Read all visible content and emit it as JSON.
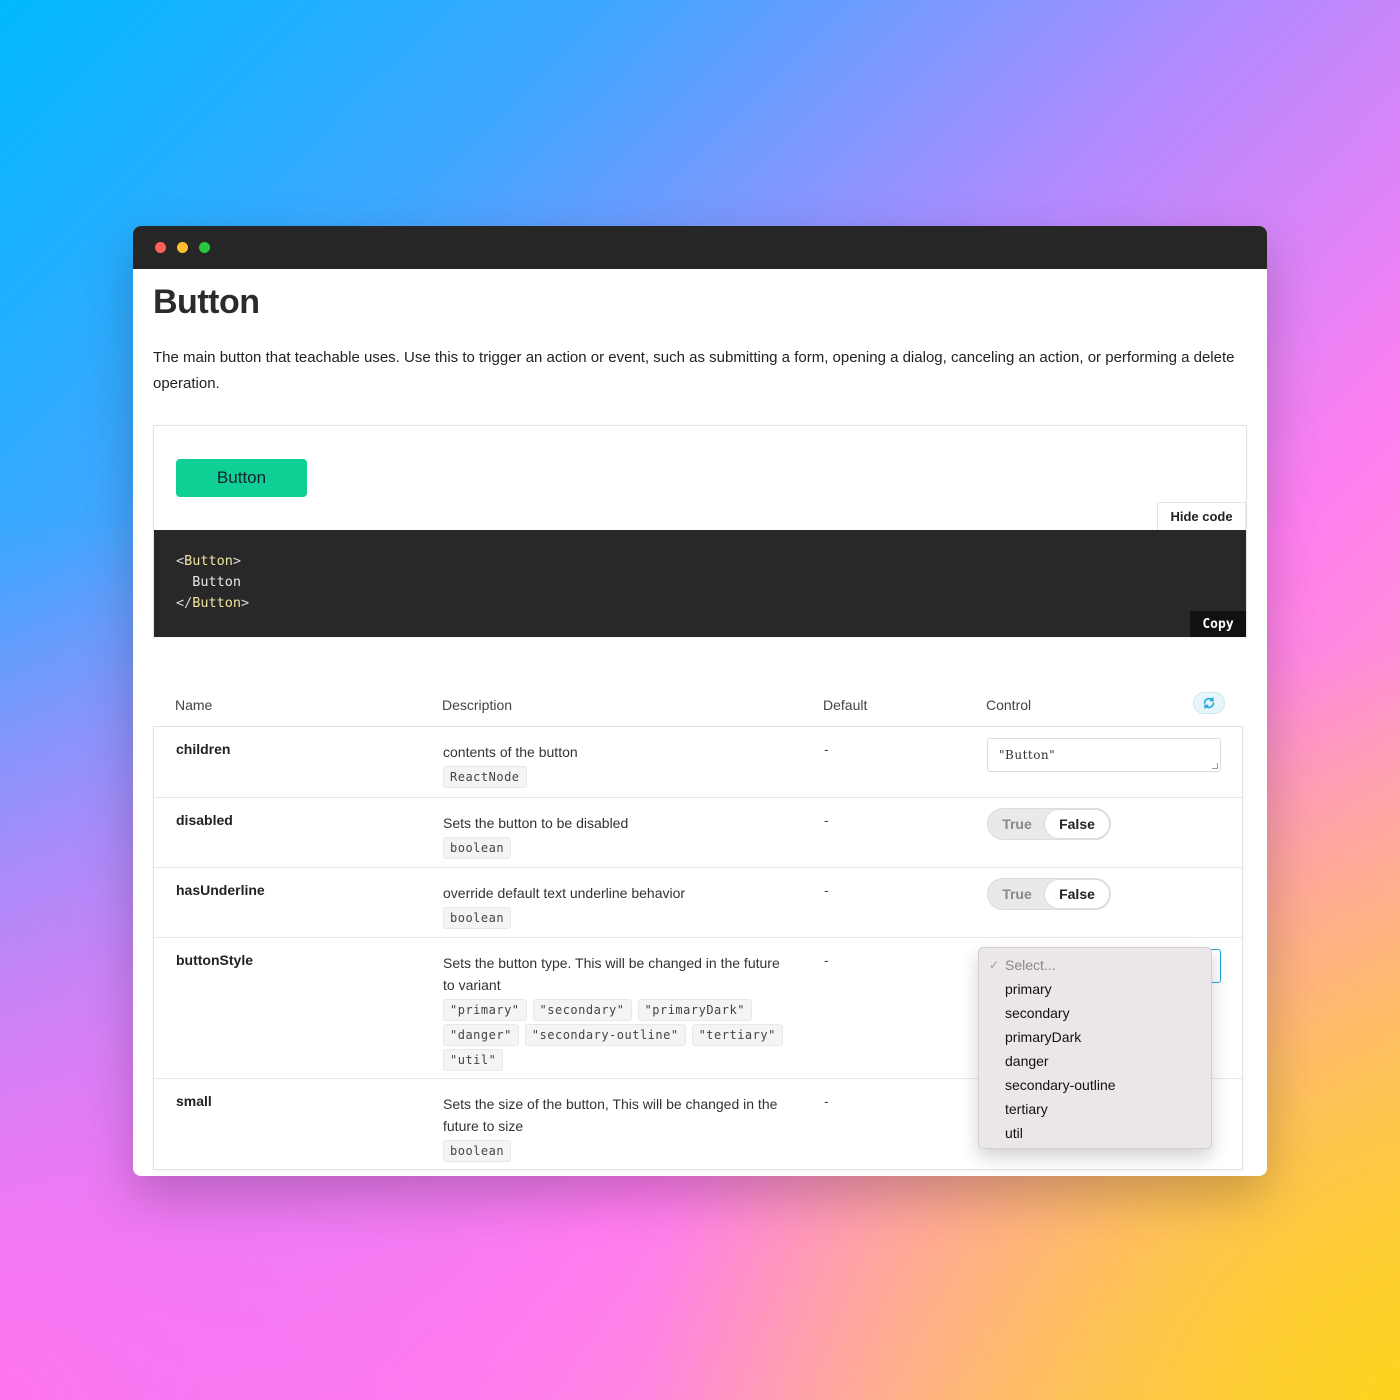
{
  "window": {
    "controls": [
      {
        "name": "close",
        "color": "#ff5f57"
      },
      {
        "name": "minimize",
        "color": "#febc2e"
      },
      {
        "name": "zoom",
        "color": "#28c840"
      }
    ]
  },
  "page": {
    "title": "Button",
    "description": "The main button that teachable uses. Use this to trigger an action or event, such as submitting a form, opening a dialog, canceling an action, or performing a delete operation."
  },
  "preview": {
    "button_label": "Button",
    "button_color": "#0ecf94",
    "hide_code_label": "Hide code",
    "code": {
      "line1_open": "<",
      "line1_tag": "Button",
      "line1_close": ">",
      "line2": "  Button",
      "line3_open": "</",
      "line3_tag": "Button",
      "line3_close": ">"
    },
    "copy_label": "Copy"
  },
  "props_table": {
    "headers": {
      "name": "Name",
      "description": "Description",
      "default": "Default",
      "control": "Control"
    },
    "reset_icon": "refresh-icon",
    "rows": [
      {
        "name": "children",
        "description": "contents of the button",
        "types": [
          "ReactNode"
        ],
        "default": "-",
        "control": {
          "kind": "text",
          "value": "\"Button\""
        }
      },
      {
        "name": "disabled",
        "description": "Sets the button to be disabled",
        "types": [
          "boolean"
        ],
        "default": "-",
        "control": {
          "kind": "toggle",
          "true_label": "True",
          "false_label": "False",
          "selected": "False"
        }
      },
      {
        "name": "hasUnderline",
        "description": "override default text underline behavior",
        "types": [
          "boolean"
        ],
        "default": "-",
        "control": {
          "kind": "toggle",
          "true_label": "True",
          "false_label": "False",
          "selected": "False"
        }
      },
      {
        "name": "buttonStyle",
        "description": "Sets the button type. This will be changed in the future to variant",
        "types": [
          "\"primary\"",
          "\"secondary\"",
          "\"primaryDark\"",
          "\"danger\"",
          "\"secondary-outline\"",
          "\"tertiary\"",
          "\"util\""
        ],
        "default": "-",
        "control": {
          "kind": "select",
          "placeholder": "Select...",
          "options": [
            "primary",
            "secondary",
            "primaryDark",
            "danger",
            "secondary-outline",
            "tertiary",
            "util"
          ]
        }
      },
      {
        "name": "small",
        "description": "Sets the size of the button, This will be changed in the future to size",
        "types": [
          "boolean"
        ],
        "default": "-"
      }
    ]
  }
}
